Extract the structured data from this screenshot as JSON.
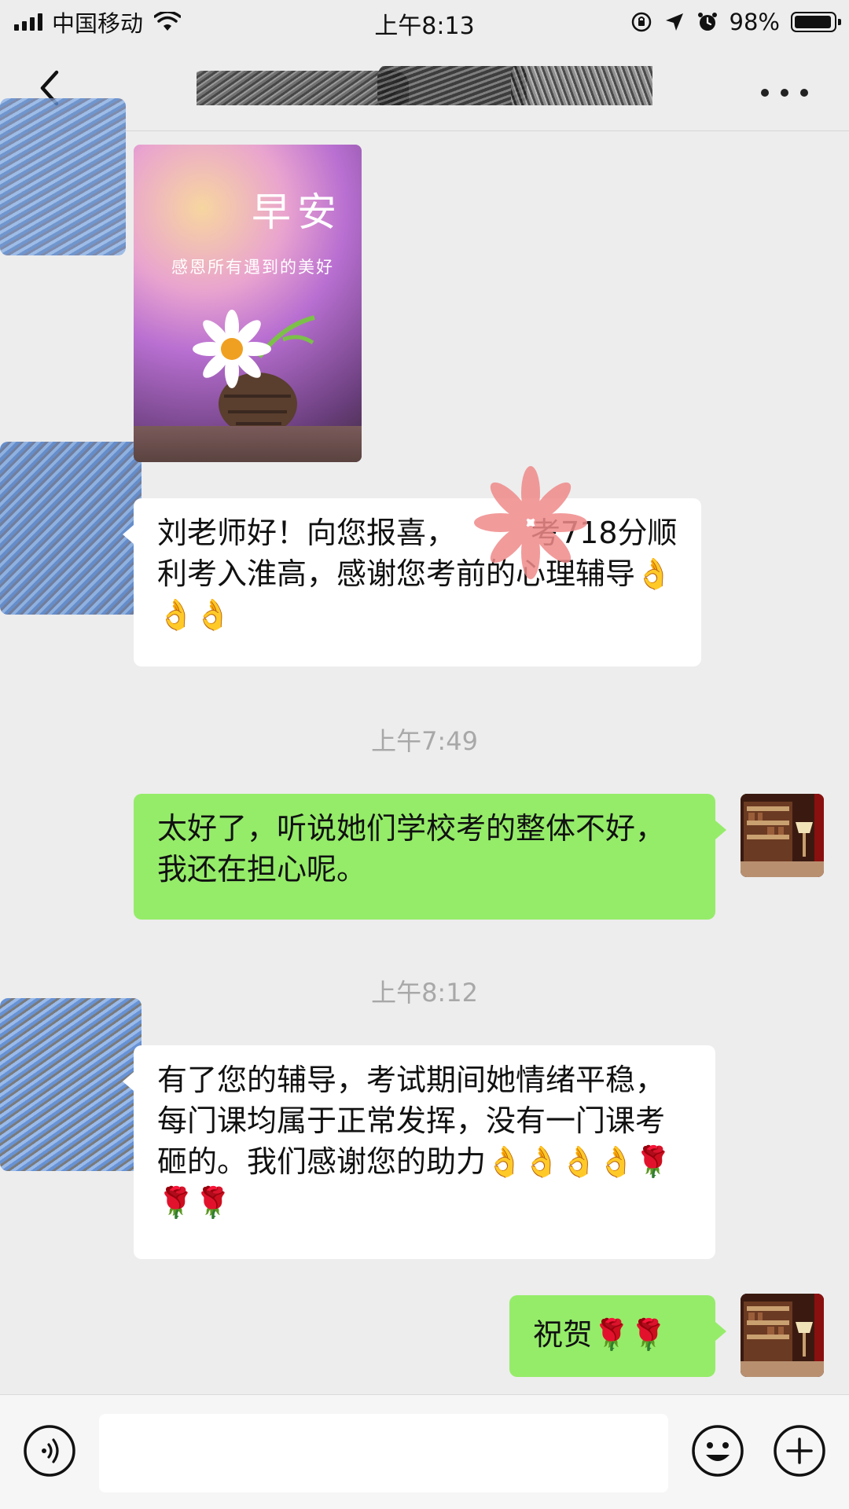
{
  "status_bar": {
    "carrier": "中国移动",
    "time": "上午8:13",
    "battery_percent": "98%",
    "battery_level": 0.98,
    "icons": [
      "signal-icon",
      "wifi-icon",
      "orientation-lock-icon",
      "location-icon",
      "alarm-icon",
      "battery-icon"
    ]
  },
  "nav": {
    "back_icon": "chevron-left-icon",
    "title": "",
    "more_icon": "more-dots-icon"
  },
  "messages": [
    {
      "type": "image",
      "direction": "incoming",
      "image_text": {
        "title": "早安",
        "subtitle": "感恩所有遇到的美好"
      }
    },
    {
      "type": "text",
      "direction": "incoming",
      "text": "刘老师好！向您报喜，　　　考718分顺利考入淮高，感谢您考前的心理辅导👌👌👌"
    },
    {
      "type": "timestamp",
      "text": "上午7:49"
    },
    {
      "type": "text",
      "direction": "outgoing",
      "text": "太好了，听说她们学校考的整体不好，我还在担心呢。"
    },
    {
      "type": "timestamp",
      "text": "上午8:12"
    },
    {
      "type": "text",
      "direction": "incoming",
      "text": "有了您的辅导，考试期间她情绪平稳，每门课均属于正常发挥，没有一门课考砸的。我们感谢您的助力👌👌👌👌🌹🌹🌹"
    },
    {
      "type": "text",
      "direction": "outgoing",
      "text": "祝贺🌹🌹"
    }
  ],
  "input_bar": {
    "voice_icon": "voice-icon",
    "text_value": "",
    "emoji_icon": "emoji-icon",
    "plus_icon": "plus-icon"
  },
  "colors": {
    "background": "#ededed",
    "incoming_bubble": "#ffffff",
    "outgoing_bubble": "#95ec69",
    "timestamp_text": "#a8a8a8"
  }
}
